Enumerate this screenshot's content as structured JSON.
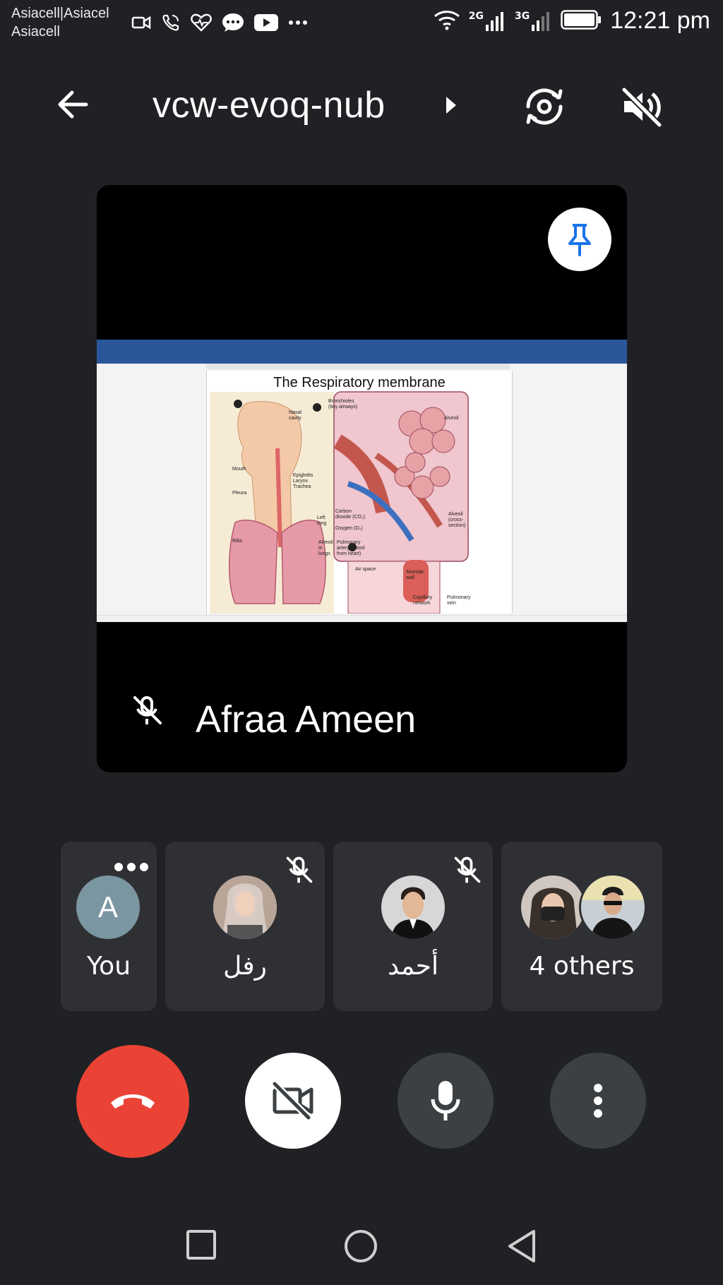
{
  "status_bar": {
    "carrier_line1": "Asiacell|Asiacel",
    "carrier_line2": "Asiacell",
    "network_1": "2G",
    "network_2": "3G",
    "time": "12:21 pm"
  },
  "header": {
    "meeting_code": "vcw-evoq-nub"
  },
  "presentation": {
    "document_title": "The Respiratory membrane",
    "presenter_name": "Afraa Ameen",
    "presenter_muted": true
  },
  "participants": [
    {
      "name": "You",
      "initial": "A",
      "muted": false,
      "avatar_color": "#7a96a1"
    },
    {
      "name": "رفل",
      "muted": true
    },
    {
      "name": "أحمد",
      "muted": true
    },
    {
      "name": "4 others",
      "muted": false
    }
  ],
  "controls": {
    "end_call_color": "#ea4335",
    "camera": "off",
    "microphone": "on"
  },
  "colors": {
    "background": "#202124",
    "tile": "#2f3034",
    "button_dark": "#3c4043",
    "accent_blue": "#1a73e8"
  },
  "icons": [
    "back-arrow-icon",
    "switch-camera-icon",
    "speaker-off-icon",
    "pin-icon",
    "mic-off-icon",
    "more-dots-icon",
    "end-call-icon",
    "camera-off-icon",
    "mic-icon",
    "more-vert-icon",
    "recent-apps-icon",
    "home-icon",
    "back-icon"
  ]
}
